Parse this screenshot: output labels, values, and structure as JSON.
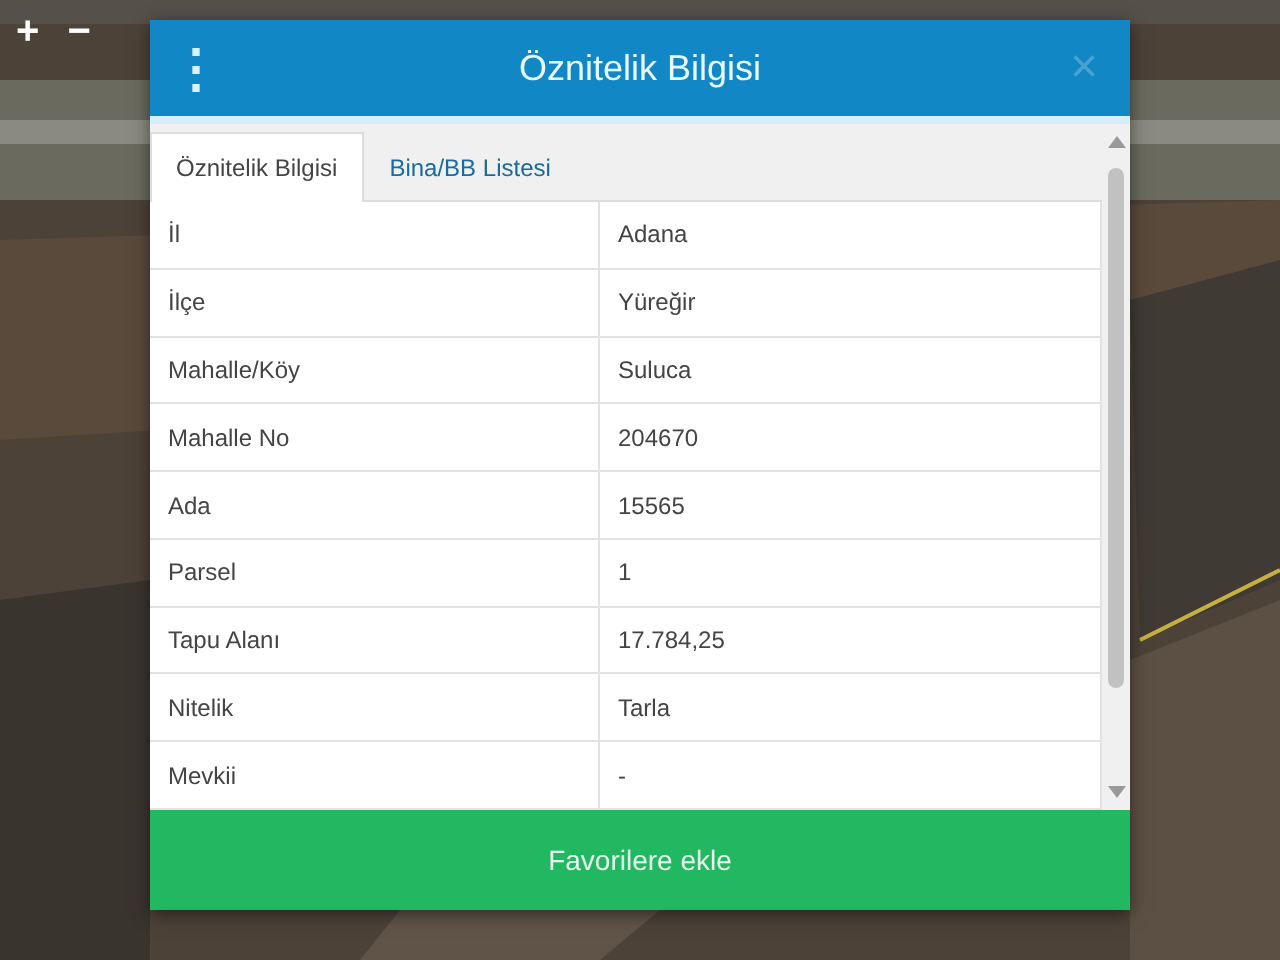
{
  "map_controls": [
    "+",
    "−"
  ],
  "dialog": {
    "menu_icon": "⋮",
    "title": "Öznitelik Bilgisi",
    "close": "×",
    "tabs": [
      {
        "label": "Öznitelik Bilgisi",
        "selected": true
      },
      {
        "label": "Bina/BB Listesi",
        "selected": false
      }
    ],
    "rows": [
      {
        "label": "İl",
        "value": "Adana"
      },
      {
        "label": "İlçe",
        "value": "Yüreğir"
      },
      {
        "label": "Mahalle/Köy",
        "value": "Suluca"
      },
      {
        "label": "Mahalle No",
        "value": "204670"
      },
      {
        "label": "Ada",
        "value": "15565"
      },
      {
        "label": "Parsel",
        "value": "1"
      },
      {
        "label": "Tapu Alanı",
        "value": "17.784,25"
      },
      {
        "label": "Nitelik",
        "value": "Tarla"
      },
      {
        "label": "Mevkii",
        "value": "-"
      }
    ],
    "action": "Favorilere ekle"
  }
}
